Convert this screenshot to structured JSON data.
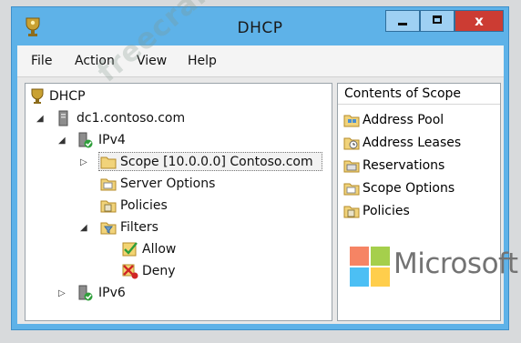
{
  "window": {
    "title": "DHCP",
    "controls": {
      "minimize_icon": "minimize-icon",
      "maximize_icon": "maximize-icon",
      "close_glyph": "x"
    }
  },
  "menu": {
    "items": [
      "File",
      "Action",
      "View",
      "Help"
    ]
  },
  "tree": {
    "root": "DHCP",
    "server": "dc1.contoso.com",
    "ipv4": "IPv4",
    "scope": "Scope [10.0.0.0] Contoso.com",
    "server_options": "Server Options",
    "policies": "Policies",
    "filters": "Filters",
    "allow": "Allow",
    "deny": "Deny",
    "ipv6": "IPv6"
  },
  "right_pane": {
    "header": "Contents of Scope",
    "items": [
      "Address Pool",
      "Address Leases",
      "Reservations",
      "Scope Options",
      "Policies"
    ]
  },
  "watermark": "freecram.net",
  "brand": {
    "text": "Microsoft",
    "colors": [
      "#f25022",
      "#7fba00",
      "#00a4ef",
      "#ffb900"
    ]
  }
}
